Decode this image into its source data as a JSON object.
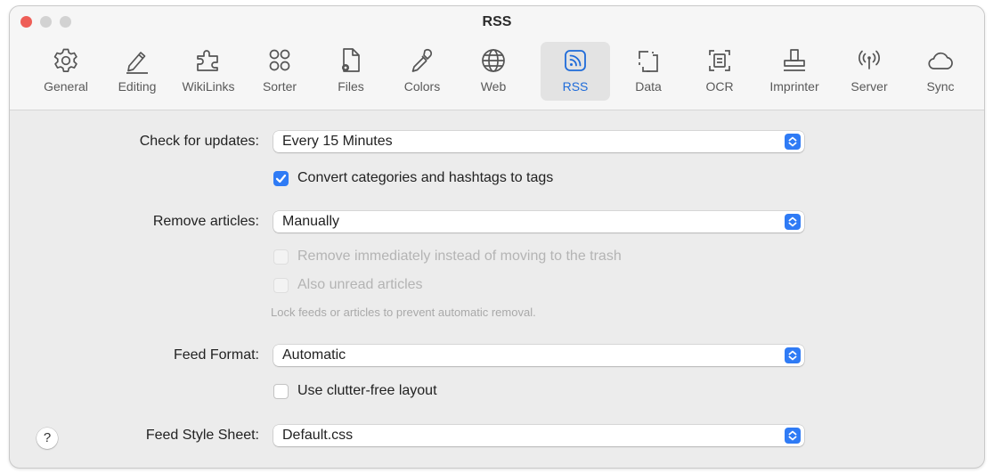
{
  "window": {
    "title": "RSS"
  },
  "toolbar": {
    "selected": "RSS",
    "accent_color": "#1e6bd9",
    "tabs": [
      {
        "label": "General",
        "icon": "gear-icon"
      },
      {
        "label": "Editing",
        "icon": "pencil-icon"
      },
      {
        "label": "WikiLinks",
        "icon": "puzzle-icon"
      },
      {
        "label": "Sorter",
        "icon": "sorter-circles-icon"
      },
      {
        "label": "Files",
        "icon": "file-gear-icon"
      },
      {
        "label": "Colors",
        "icon": "eyedropper-icon"
      },
      {
        "label": "Web",
        "icon": "globe-icon"
      },
      {
        "label": "RSS",
        "icon": "rss-icon"
      },
      {
        "label": "Data",
        "icon": "data-frame-icon"
      },
      {
        "label": "OCR",
        "icon": "ocr-scan-icon"
      },
      {
        "label": "Imprinter",
        "icon": "stamp-icon"
      },
      {
        "label": "Server",
        "icon": "broadcast-icon"
      },
      {
        "label": "Sync",
        "icon": "cloud-icon"
      }
    ]
  },
  "settings": {
    "check_updates": {
      "label": "Check for updates:",
      "value": "Every 15 Minutes"
    },
    "convert_tags": {
      "label": "Convert categories and hashtags to tags",
      "checked": true
    },
    "remove_articles": {
      "label": "Remove articles:",
      "value": "Manually"
    },
    "remove_immediately": {
      "label": "Remove immediately instead of moving to the trash",
      "checked": false,
      "enabled": false
    },
    "also_unread": {
      "label": "Also unread articles",
      "checked": false,
      "enabled": false
    },
    "lock_hint": "Lock feeds or articles to prevent automatic removal.",
    "feed_format": {
      "label": "Feed Format:",
      "value": "Automatic"
    },
    "clutter_free": {
      "label": "Use clutter-free layout",
      "checked": false
    },
    "style_sheet": {
      "label": "Feed Style Sheet:",
      "value": "Default.css"
    }
  },
  "help": {
    "label": "?"
  }
}
